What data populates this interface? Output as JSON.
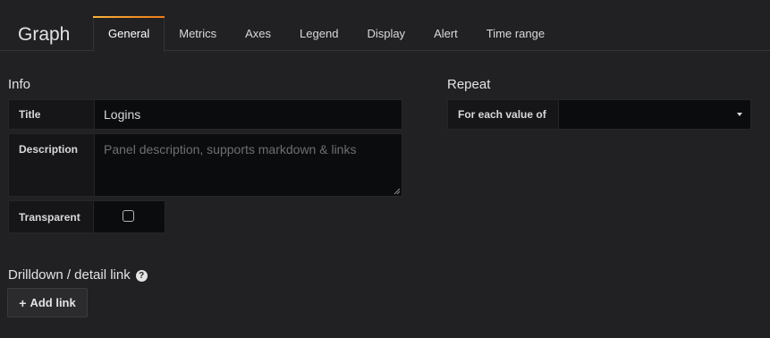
{
  "header": {
    "panel_type": "Graph",
    "tabs": [
      {
        "label": "General",
        "active": true
      },
      {
        "label": "Metrics",
        "active": false
      },
      {
        "label": "Axes",
        "active": false
      },
      {
        "label": "Legend",
        "active": false
      },
      {
        "label": "Display",
        "active": false
      },
      {
        "label": "Alert",
        "active": false
      },
      {
        "label": "Time range",
        "active": false
      }
    ]
  },
  "info": {
    "section_title": "Info",
    "title_label": "Title",
    "title_value": "Logins",
    "description_label": "Description",
    "description_placeholder": "Panel description, supports markdown & links",
    "transparent_label": "Transparent",
    "transparent_checked": false
  },
  "repeat": {
    "section_title": "Repeat",
    "for_each_label": "For each value of",
    "for_each_value": ""
  },
  "drilldown": {
    "section_title": "Drilldown / detail link",
    "help_icon": "question-circle-icon",
    "add_link_icon": "plus-icon",
    "add_link_label": "Add link"
  },
  "colors": {
    "background": "#212124",
    "active_tab_accent": "#eb7b18",
    "input_background": "#0b0c0e",
    "label_background": "#161618"
  }
}
